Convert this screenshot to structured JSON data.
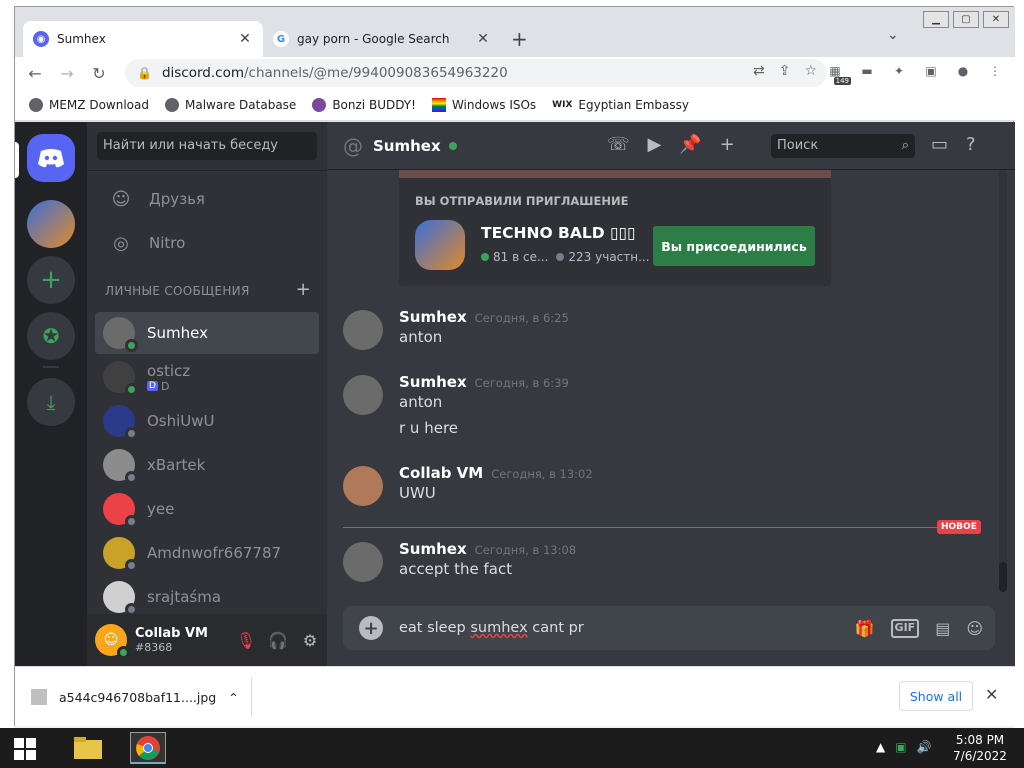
{
  "colors": {
    "discord_blurple": "#5865f2",
    "discord_green": "#3ba55d",
    "discord_red": "#ed4245",
    "discord_bg": "#36393f"
  },
  "browser": {
    "tabs": [
      {
        "title": "Sumhex",
        "favicon": "discord-icon",
        "active": true
      },
      {
        "title": "gay porn - Google Search",
        "favicon": "google-icon",
        "active": false
      }
    ],
    "url": {
      "host": "discord.com",
      "path": "/channels/@me/994009083654963220"
    },
    "extension_badge": "149",
    "bookmarks": [
      {
        "label": "MEMZ Download"
      },
      {
        "label": "Malware Database"
      },
      {
        "label": "Bonzi BUDDY!"
      },
      {
        "label": "Windows ISOs"
      },
      {
        "label": "Egyptian Embassy"
      }
    ]
  },
  "discord": {
    "dm_search_placeholder": "Найти или начать беседу",
    "nav": {
      "friends": "Друзья",
      "nitro": "Nitro"
    },
    "dm_header": "ЛИЧНЫЕ СООБЩЕНИЯ",
    "dms": [
      {
        "name": "Sumhex",
        "status": "online",
        "selected": true,
        "avatar_color": "#6b6b6b"
      },
      {
        "name": "osticz",
        "status": "online",
        "sub": "D",
        "avatar_color": "#404040"
      },
      {
        "name": "OshiUwU",
        "status": "offline",
        "avatar_color": "#2b3a8a"
      },
      {
        "name": "xBartek",
        "status": "offline",
        "avatar_color": "#8c8c8c"
      },
      {
        "name": "yee",
        "status": "offline",
        "avatar_color": "#ed4245"
      },
      {
        "name": "Amdnwofr667787",
        "status": "offline",
        "avatar_color": "#c9a227"
      },
      {
        "name": "srajtaśma",
        "status": "offline",
        "avatar_color": "#d0d0d0"
      }
    ],
    "user": {
      "name": "Collab VM",
      "tag": "#8368"
    },
    "channel": {
      "name": "Sumhex",
      "search_placeholder": "Поиск"
    },
    "invite": {
      "label": "ВЫ ОТПРАВИЛИ ПРИГЛАШЕНИЕ",
      "server_name": "TECHNO BALD ▯▯▯",
      "online": "81 в се...",
      "members": "223 участн...",
      "button": "Вы присоединились"
    },
    "messages": [
      {
        "author": "Sumhex",
        "time": "Сегодня, в 6:25",
        "lines": [
          "anton"
        ],
        "avatar_color": "#6b6b6b"
      },
      {
        "author": "Sumhex",
        "time": "Сегодня, в 6:39",
        "lines": [
          "anton",
          "r u here"
        ],
        "avatar_color": "#6b6b6b"
      },
      {
        "author": "Collab VM",
        "time": "Сегодня, в 13:02",
        "lines": [
          "UWU"
        ],
        "avatar_color": "#b07a5a"
      },
      {
        "author": "Sumhex",
        "time": "Сегодня, в 13:08",
        "lines": [
          "accept the fact"
        ],
        "avatar_color": "#6b6b6b"
      }
    ],
    "new_badge": "НОВОЕ",
    "composer": {
      "before": "eat sleep ",
      "misspelled": "sumhex",
      "after": " cant pr"
    }
  },
  "download": {
    "filename": "a544c946708baf11....jpg",
    "show_all": "Show all"
  },
  "taskbar": {
    "time": "5:08 PM",
    "date": "7/6/2022"
  }
}
